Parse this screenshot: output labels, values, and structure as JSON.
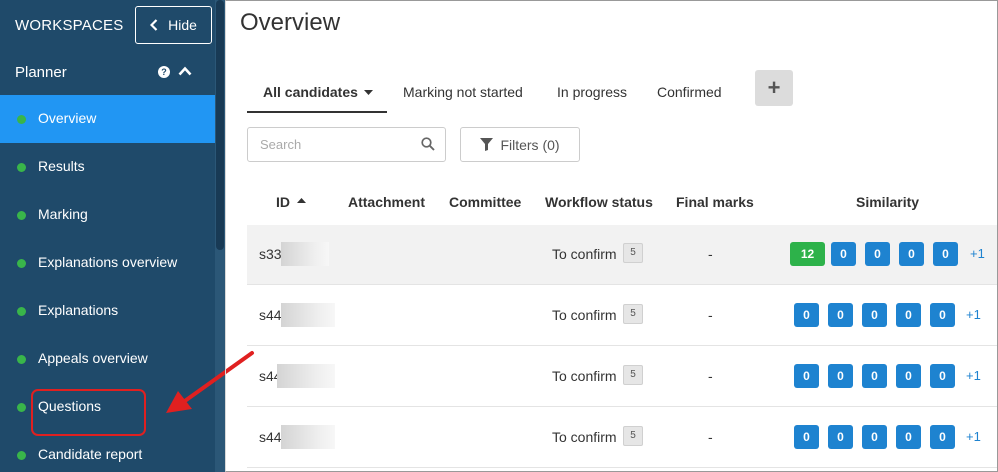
{
  "sidebar": {
    "workspaces_label": "WORKSPACES",
    "hide_label": "Hide",
    "section_label": "Planner",
    "items": [
      {
        "label": "Overview",
        "active": true
      },
      {
        "label": "Results"
      },
      {
        "label": "Marking"
      },
      {
        "label": "Explanations overview"
      },
      {
        "label": "Explanations"
      },
      {
        "label": "Appeals overview"
      },
      {
        "label": "Questions"
      },
      {
        "label": "Candidate report"
      }
    ]
  },
  "main": {
    "title": "Overview",
    "tabs": [
      "All candidates",
      "Marking not started",
      "In progress",
      "Confirmed"
    ],
    "search_placeholder": "Search",
    "filters_label": "Filters (0)",
    "columns": [
      "ID",
      "Attachment",
      "Committee",
      "Workflow status",
      "Final marks",
      "Similarity"
    ],
    "rows": [
      {
        "id": "s33",
        "workflow": "To confirm",
        "count": "5",
        "final": "-",
        "similarity": [
          "12",
          "0",
          "0",
          "0",
          "0"
        ],
        "more": "+1"
      },
      {
        "id": "s44",
        "workflow": "To confirm",
        "count": "5",
        "final": "-",
        "similarity": [
          "0",
          "0",
          "0",
          "0",
          "0"
        ],
        "more": "+1"
      },
      {
        "id": "s44",
        "workflow": "To confirm",
        "count": "5",
        "final": "-",
        "similarity": [
          "0",
          "0",
          "0",
          "0",
          "0"
        ],
        "more": "+1"
      },
      {
        "id": "s44",
        "workflow": "To confirm",
        "count": "5",
        "final": "-",
        "similarity": [
          "0",
          "0",
          "0",
          "0",
          "0"
        ],
        "more": "+1"
      }
    ]
  },
  "colors": {
    "sidebar_bg": "#1f4a6a",
    "active_item": "#2196f3",
    "status_dot": "#39b54a",
    "similarity_blue": "#1e83d0",
    "similarity_green": "#2db24a",
    "annotation_red": "#e02020"
  }
}
